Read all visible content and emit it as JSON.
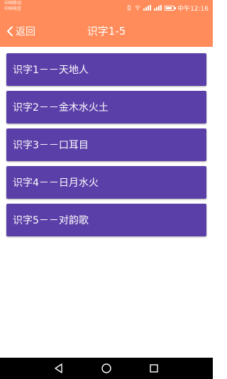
{
  "status_bar": {
    "carrier_1": "中国移动",
    "carrier_2": "中国电信",
    "time": "中午12:16"
  },
  "toolbar": {
    "back_label": "返回",
    "title": "识字1-5"
  },
  "list": {
    "items": [
      {
        "label": "识字1－－天地人"
      },
      {
        "label": "识字2－－金木水火土"
      },
      {
        "label": "识字3－－口耳目"
      },
      {
        "label": "识字4－－日月水火"
      },
      {
        "label": "识字5－－对韵歌"
      }
    ]
  },
  "colors": {
    "accent": "#ff8c5a",
    "item_background": "#5b3fa8",
    "nav_background": "#000000"
  },
  "icons": {
    "back": "chevron-left-icon",
    "nav_back": "triangle-back-icon",
    "nav_home": "circle-home-icon",
    "nav_recent": "square-recent-icon"
  }
}
